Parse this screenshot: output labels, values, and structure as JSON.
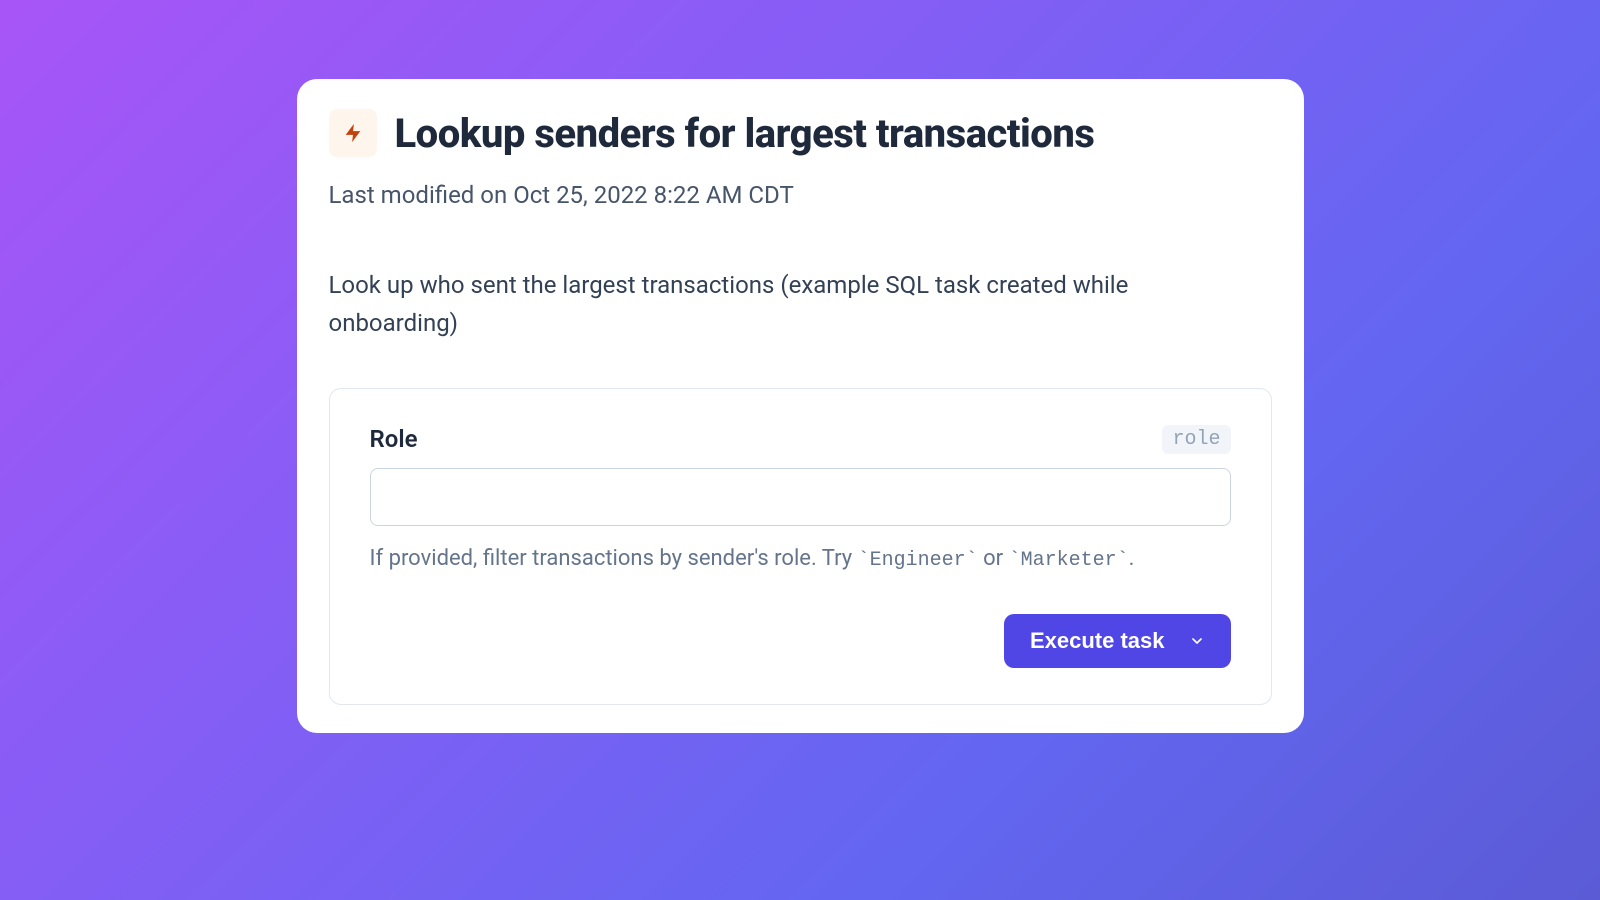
{
  "header": {
    "title": "Lookup senders for largest transactions",
    "last_modified": "Last modified on Oct 25, 2022 8:22 AM CDT"
  },
  "description": "Look up who sent the largest transactions (example SQL task created while onboarding)",
  "form": {
    "role": {
      "label": "Role",
      "badge": "role",
      "value": "",
      "help_prefix": "If provided, filter transactions by sender's role. Try ",
      "help_code1": "`Engineer`",
      "help_or": " or ",
      "help_code2": "`Marketer`",
      "help_suffix": "."
    },
    "execute_label": "Execute task"
  }
}
